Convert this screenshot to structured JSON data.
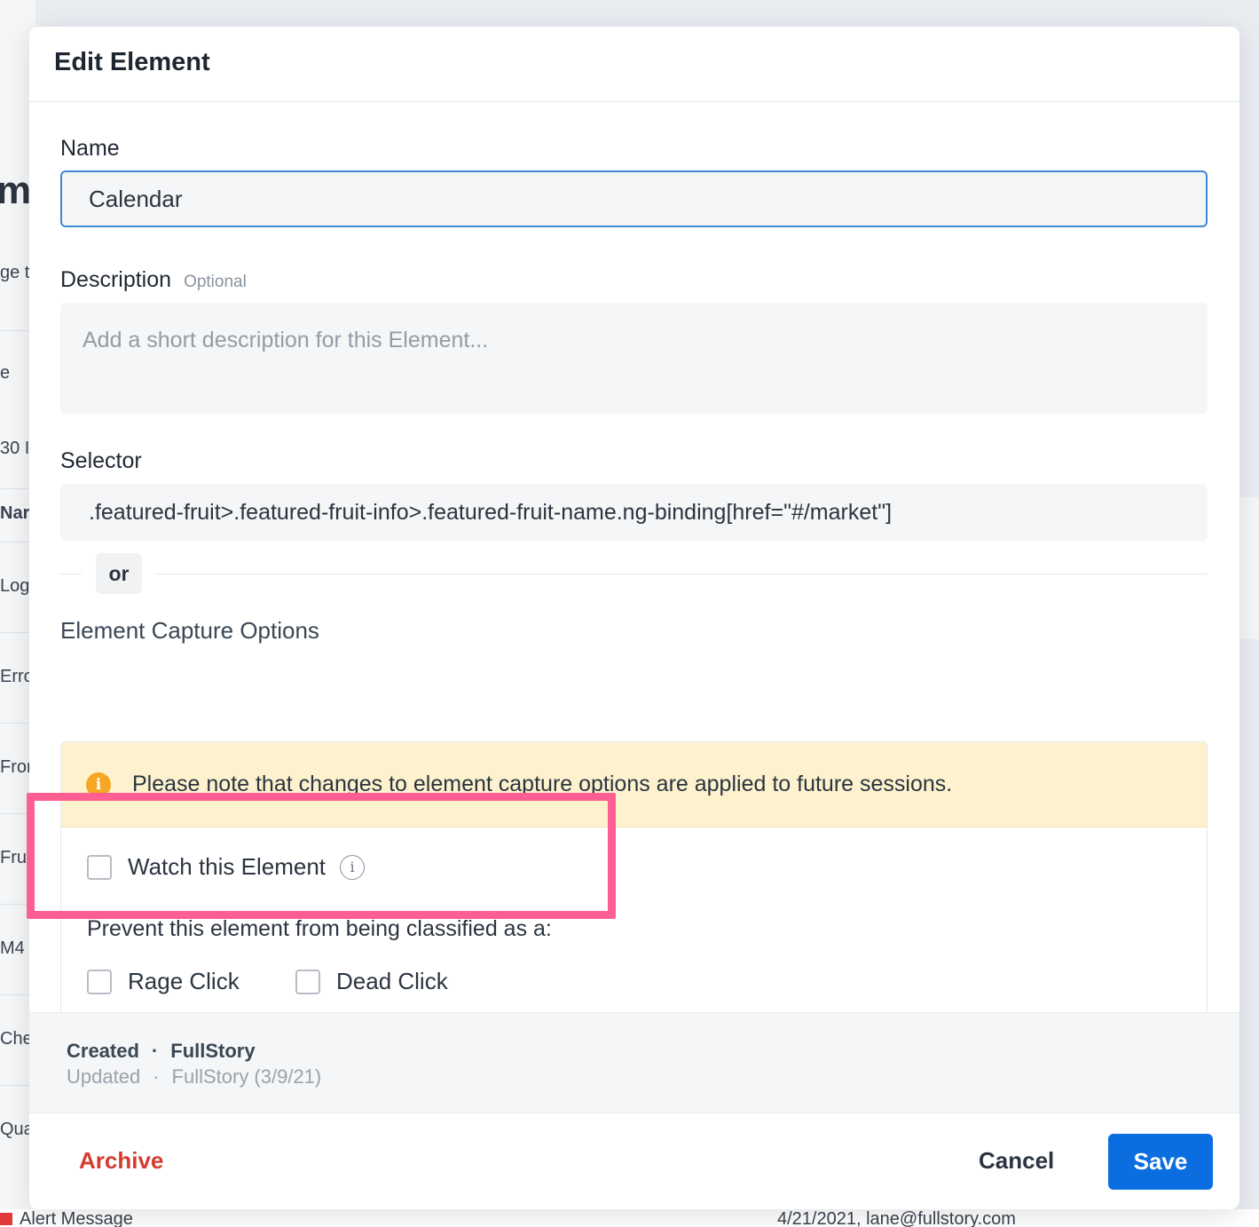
{
  "background": {
    "page_title_fragment": "me",
    "rows": [
      "ge t",
      "e",
      "30 I",
      "Nar",
      "Log",
      "Erro",
      "Fror",
      "Frui",
      "M4",
      "Che",
      "Qua"
    ],
    "bottom_left": "Alert Message",
    "bottom_right": "4/21/2021, lane@fullstory.com"
  },
  "modal": {
    "title": "Edit Element",
    "name": {
      "label": "Name",
      "value": "Calendar"
    },
    "description": {
      "label": "Description",
      "optional": "Optional",
      "placeholder": "Add a short description for this Element..."
    },
    "selector": {
      "label": "Selector",
      "value": ".featured-fruit>.featured-fruit-info>.featured-fruit-name.ng-binding[href=\"#/market\"]"
    },
    "or_label": "or",
    "capture": {
      "title": "Element Capture Options",
      "notice": "Please note that changes to element capture options are applied to future sessions.",
      "watch_label": "Watch this Element",
      "prevent_label": "Prevent this element from being classified as a:",
      "rage_click_label": "Rage Click",
      "dead_click_label": "Dead Click"
    },
    "meta": {
      "created_label": "Created",
      "created_by": "FullStory",
      "updated_label": "Updated",
      "updated_by": "FullStory (3/9/21)",
      "separator": "·"
    },
    "footer": {
      "archive": "Archive",
      "cancel": "Cancel",
      "save": "Save"
    }
  },
  "colors": {
    "primary": "#0b6ee0",
    "danger": "#d53b2f",
    "notice_bg": "#fdf2cd",
    "notice_icon": "#f5a623",
    "highlight": "#ff5e92"
  }
}
